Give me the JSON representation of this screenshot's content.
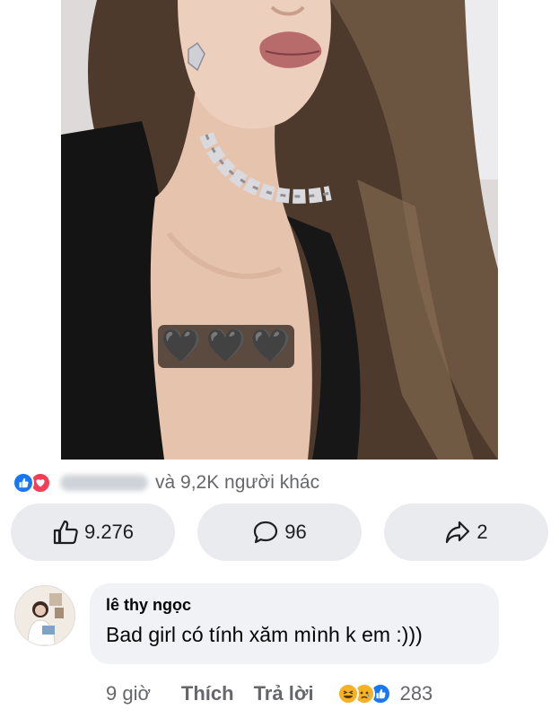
{
  "post": {
    "photo_alt": "",
    "censor_hearts": [
      "🖤",
      "🖤",
      "🖤"
    ]
  },
  "reactions": {
    "icons": [
      "like-icon",
      "love-icon"
    ],
    "summary_text": "và 9,2K người khác"
  },
  "actions": {
    "like_count": "9.276",
    "comment_count": "96",
    "share_count": "2"
  },
  "comment": {
    "author": "lê thy ngọc",
    "text": "Bad girl có tính xăm mình k em :)))",
    "time": "9 giờ",
    "like_label": "Thích",
    "reply_label": "Trả lời",
    "reaction_icons": [
      "haha-icon",
      "sad-icon",
      "like-icon"
    ],
    "reaction_count": "283"
  },
  "colors": {
    "facebook_blue": "#1877f2",
    "love_red": "#f33e58",
    "pill_bg": "#e9ebef",
    "bubble_bg": "#f0f2f5",
    "secondary_text": "#65676b"
  }
}
